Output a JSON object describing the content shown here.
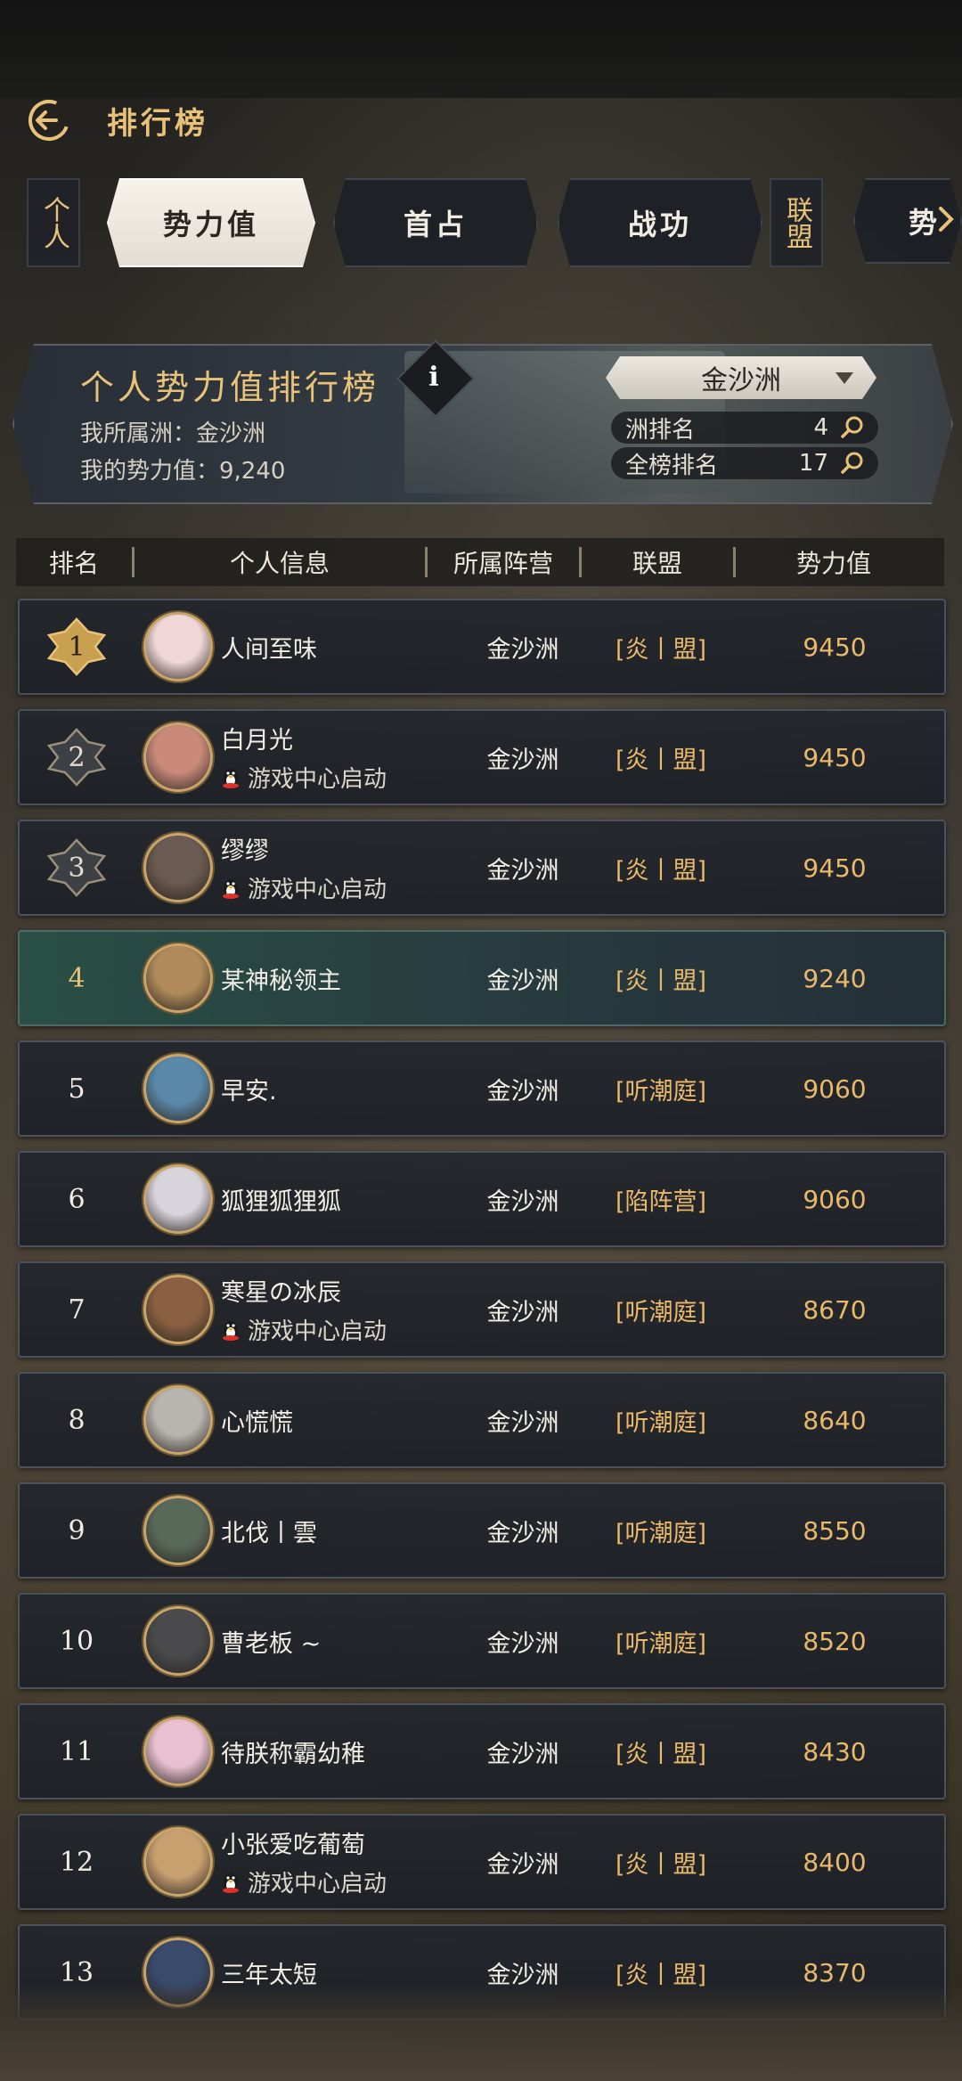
{
  "header": {
    "title": "排行榜"
  },
  "tabs": {
    "left_vertical": "个人",
    "items": [
      "势力值",
      "首占",
      "战功"
    ],
    "right_vertical": "联盟",
    "partial": "势"
  },
  "banner": {
    "title": "个人势力值排行榜",
    "zone_label": "我所属洲：金沙洲",
    "power_label": "我的势力值：9,240",
    "select_value": "金沙洲",
    "zone_rank_label": "洲排名",
    "zone_rank": "4",
    "global_rank_label": "全榜排名",
    "global_rank": "17"
  },
  "table": {
    "headers": [
      "排名",
      "个人信息",
      "所属阵营",
      "联盟",
      "势力值"
    ],
    "rows": [
      {
        "rank": "1",
        "name": "人间至味",
        "sub": "",
        "camp": "金沙洲",
        "alliance": "[炎丨盟]",
        "power": "9450",
        "color": "#f0d6d6"
      },
      {
        "rank": "2",
        "name": "白月光",
        "sub": "游戏中心启动",
        "camp": "金沙洲",
        "alliance": "[炎丨盟]",
        "power": "9450",
        "color": "#c98a7a"
      },
      {
        "rank": "3",
        "name": "缪缪",
        "sub": "游戏中心启动",
        "camp": "金沙洲",
        "alliance": "[炎丨盟]",
        "power": "9450",
        "color": "#6a5a52"
      },
      {
        "rank": "4",
        "name": "某神秘领主",
        "sub": "",
        "camp": "金沙洲",
        "alliance": "[炎丨盟]",
        "power": "9240",
        "color": "#b08a5a"
      },
      {
        "rank": "5",
        "name": "早安.",
        "sub": "",
        "camp": "金沙洲",
        "alliance": "[听潮庭]",
        "power": "9060",
        "color": "#5a88a8"
      },
      {
        "rank": "6",
        "name": "狐狸狐狸狐",
        "sub": "",
        "camp": "金沙洲",
        "alliance": "[陷阵营]",
        "power": "9060",
        "color": "#d8d4dc"
      },
      {
        "rank": "7",
        "name": "寒星の冰辰",
        "sub": "游戏中心启动",
        "camp": "金沙洲",
        "alliance": "[听潮庭]",
        "power": "8670",
        "color": "#8a6040"
      },
      {
        "rank": "8",
        "name": "心慌慌",
        "sub": "",
        "camp": "金沙洲",
        "alliance": "[听潮庭]",
        "power": "8640",
        "color": "#b8b4b0"
      },
      {
        "rank": "9",
        "name": "北伐丨雲",
        "sub": "",
        "camp": "金沙洲",
        "alliance": "[听潮庭]",
        "power": "8550",
        "color": "#5a6a5a"
      },
      {
        "rank": "10",
        "name": "曹老板 ~",
        "sub": "",
        "camp": "金沙洲",
        "alliance": "[听潮庭]",
        "power": "8520",
        "color": "#4a4a4c"
      },
      {
        "rank": "11",
        "name": "待朕称霸幼稚",
        "sub": "",
        "camp": "金沙洲",
        "alliance": "[炎丨盟]",
        "power": "8430",
        "color": "#e8c0d0"
      },
      {
        "rank": "12",
        "name": "小张爱吃葡萄",
        "sub": "游戏中心启动",
        "camp": "金沙洲",
        "alliance": "[炎丨盟]",
        "power": "8400",
        "color": "#c8a070"
      },
      {
        "rank": "13",
        "name": "三年太短",
        "sub": "",
        "camp": "金沙洲",
        "alliance": "[炎丨盟]",
        "power": "8370",
        "color": "#3a4a6a"
      }
    ]
  },
  "colors": {
    "accent": "#e9c27a",
    "my_row": "#2a5048"
  }
}
